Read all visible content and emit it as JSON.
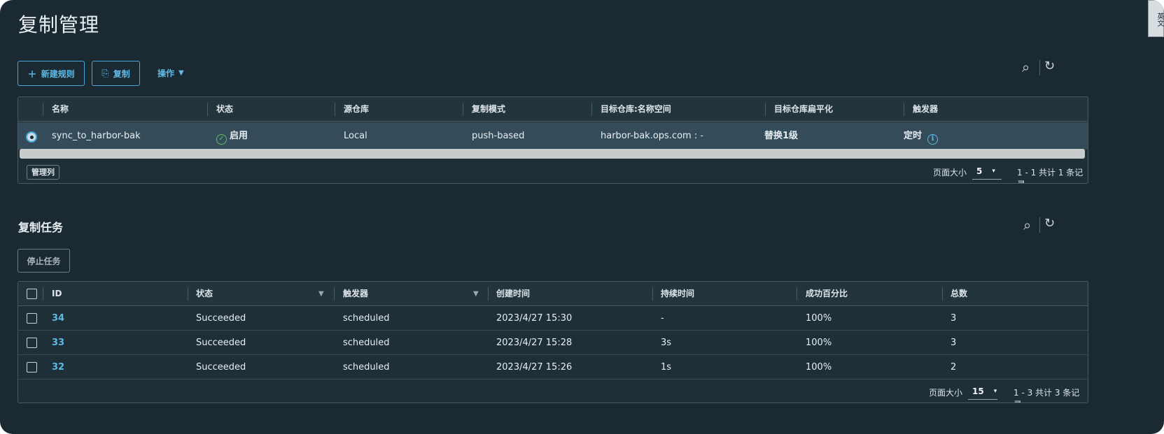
{
  "page_title": "复制管理",
  "side_tab_label": "英文",
  "toolbar": {
    "new_rule_label": "新建规则",
    "replicate_label": "复制",
    "actions_label": "操作"
  },
  "rules_table": {
    "headers": [
      "名称",
      "状态",
      "源仓库",
      "复制模式",
      "目标仓库:名称空间",
      "目标仓库扁平化",
      "触发器"
    ],
    "rows": [
      {
        "name": "sync_to_harbor-bak",
        "status": "启用",
        "source": "Local",
        "mode": "push-based",
        "target": "harbor-bak.ops.com : -",
        "flatten": "替换1级",
        "trigger": "定时"
      }
    ],
    "manage_columns_label": "管理列",
    "page_size_label": "页面大小",
    "page_size": "5",
    "summary": "1 - 1 共计 1 条记录"
  },
  "tasks_section": {
    "title": "复制任务",
    "stop_label": "停止任务",
    "headers": [
      "ID",
      "状态",
      "触发器",
      "创建时间",
      "持续时间",
      "成功百分比",
      "总数"
    ],
    "rows": [
      {
        "id": "34",
        "status": "Succeeded",
        "trigger": "scheduled",
        "created": "2023/4/27 15:30",
        "duration": "-",
        "success": "100%",
        "total": "3"
      },
      {
        "id": "33",
        "status": "Succeeded",
        "trigger": "scheduled",
        "created": "2023/4/27 15:28",
        "duration": "3s",
        "success": "100%",
        "total": "3"
      },
      {
        "id": "32",
        "status": "Succeeded",
        "trigger": "scheduled",
        "created": "2023/4/27 15:26",
        "duration": "1s",
        "success": "100%",
        "total": "2"
      }
    ],
    "page_size_label": "页面大小",
    "page_size": "15",
    "summary": "1 - 3 共计 3 条记录"
  },
  "colors": {
    "background": "#1b2a32",
    "accent": "#5fb9e6",
    "success": "#5fbf6a",
    "selected_row": "#344c5a"
  }
}
